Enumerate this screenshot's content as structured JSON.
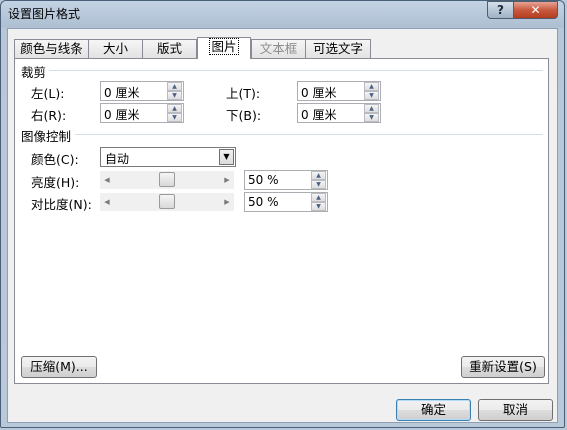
{
  "window": {
    "title": "设置图片格式",
    "help_label": "?",
    "close_label": "✕"
  },
  "tabs": [
    {
      "label": "颜色与线条",
      "state": "normal"
    },
    {
      "label": "大小",
      "state": "normal"
    },
    {
      "label": "版式",
      "state": "normal"
    },
    {
      "label": "图片",
      "state": "active"
    },
    {
      "label": "文本框",
      "state": "disabled"
    },
    {
      "label": "可选文字",
      "state": "normal"
    }
  ],
  "crop": {
    "title": "裁剪",
    "left": {
      "label": "左(L):",
      "value": "0 厘米"
    },
    "top": {
      "label": "上(T):",
      "value": "0 厘米"
    },
    "right": {
      "label": "右(R):",
      "value": "0 厘米"
    },
    "bottom": {
      "label": "下(B):",
      "value": "0 厘米"
    }
  },
  "image_control": {
    "title": "图像控制",
    "color": {
      "label": "颜色(C):",
      "value": "自动"
    },
    "brightness": {
      "label": "亮度(H):",
      "value": "50 %",
      "level": 0.5
    },
    "contrast": {
      "label": "对比度(N):",
      "value": "50 %",
      "level": 0.5
    }
  },
  "buttons": {
    "compress": "压缩(M)...",
    "reset": "重新设置(S)",
    "ok": "确定",
    "cancel": "取消"
  },
  "icons": {
    "spin_up": "spin-up-icon",
    "spin_down": "spin-down-icon",
    "dropdown": "chevron-down-icon",
    "slider_left": "arrow-left-icon",
    "slider_right": "arrow-right-icon"
  }
}
